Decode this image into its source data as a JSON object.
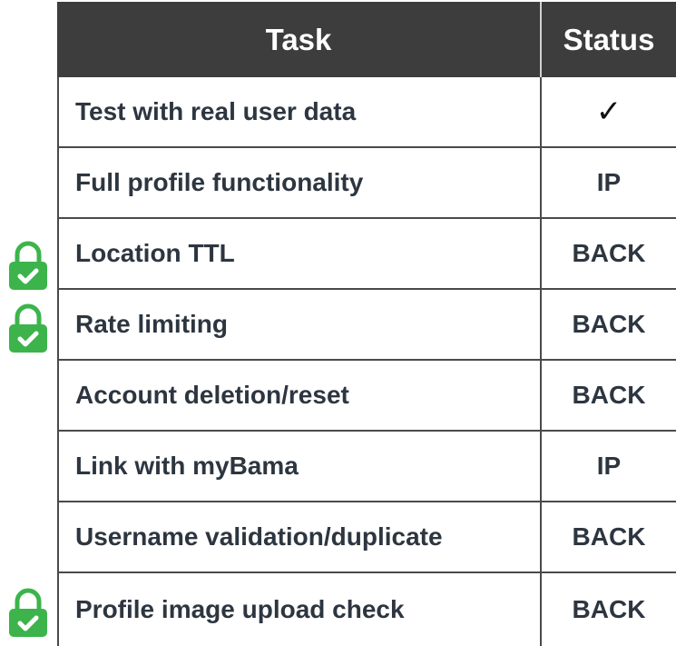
{
  "table": {
    "headers": {
      "task": "Task",
      "status": "Status"
    },
    "rows": [
      {
        "task": "Test with real user data",
        "status": "✓",
        "locked": false
      },
      {
        "task": "Full profile functionality",
        "status": "IP",
        "locked": false
      },
      {
        "task": "Location TTL",
        "status": "BACK",
        "locked": true
      },
      {
        "task": "Rate limiting",
        "status": "BACK",
        "locked": true
      },
      {
        "task": "Account deletion/reset",
        "status": "BACK",
        "locked": false
      },
      {
        "task": "Link with myBama",
        "status": "IP",
        "locked": false
      },
      {
        "task": "Username validation/duplicate",
        "status": "BACK",
        "locked": false
      },
      {
        "task": "Profile image upload check",
        "status": "BACK",
        "locked": true
      }
    ]
  },
  "icons": {
    "lock": "lock-check-icon",
    "lock_color": "#3cb44b"
  }
}
